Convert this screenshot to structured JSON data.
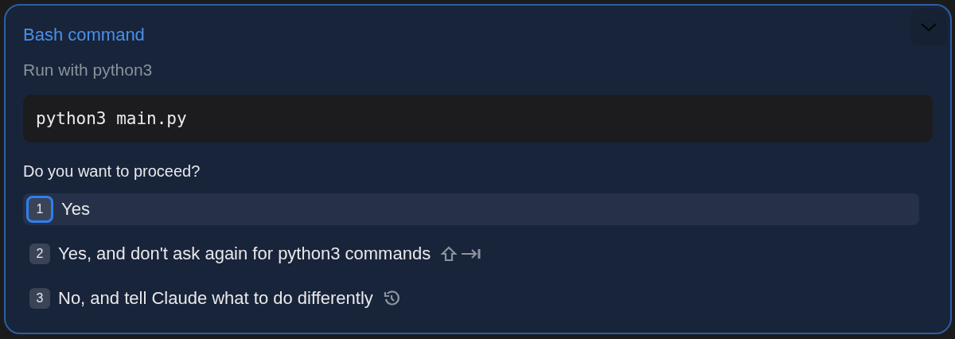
{
  "title": "Bash command",
  "subtitle": "Run with python3",
  "command": "python3 main.py",
  "question": "Do you want to proceed?",
  "options": [
    {
      "number": "1",
      "label": "Yes",
      "selected": true,
      "kind": "plain"
    },
    {
      "number": "2",
      "label": "Yes, and don't ask again for python3 commands",
      "selected": false,
      "kind": "shift-tab"
    },
    {
      "number": "3",
      "label": "No, and tell Claude what to do differently",
      "selected": false,
      "kind": "undo"
    }
  ]
}
